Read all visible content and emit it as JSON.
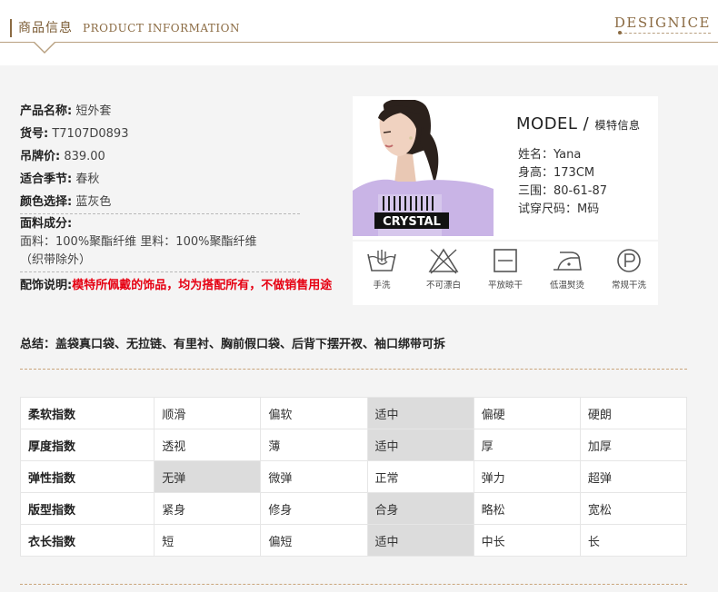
{
  "header": {
    "title_cn": "商品信息",
    "title_en": "PRODUCT INFORMATION",
    "brand": "DESIGNICE"
  },
  "product": {
    "name_label": "产品名称:",
    "name": "短外套",
    "sku_label": "货号:",
    "sku": "T7107D0893",
    "price_label": "吊牌价:",
    "price": "839.00",
    "season_label": "适合季节:",
    "season": "春秋",
    "color_label": "颜色选择:",
    "color": "蓝灰色",
    "fabric_label": "面料成分:",
    "fabric": "面料：100%聚酯纤维 里料：100%聚酯纤维",
    "fabric_note": "（织带除外）",
    "accessory_label": "配饰说明:",
    "accessory": "模特所佩戴的饰品，均为搭配所有，不做销售用途"
  },
  "model": {
    "title": "MODEL /",
    "title_sub": "模特信息",
    "name": "姓名：Yana",
    "height": "身高：173CM",
    "measurements": "三围：80-61-87",
    "size": "试穿尺码：M码",
    "shirt_text": "CRYSTAL"
  },
  "care": [
    {
      "label": "手洗",
      "icon": "hand-wash-icon"
    },
    {
      "label": "不可漂白",
      "icon": "no-bleach-icon"
    },
    {
      "label": "平放晾干",
      "icon": "dry-flat-icon"
    },
    {
      "label": "低温熨烫",
      "icon": "low-iron-icon"
    },
    {
      "label": "常规干洗",
      "icon": "dry-clean-icon"
    }
  ],
  "summary": "总结：盖袋真口袋、无拉链、有里衬、胸前假口袋、后背下摆开衩、袖口绑带可拆",
  "indices": [
    {
      "name": "柔软指数",
      "options": [
        "顺滑",
        "偏软",
        "适中",
        "偏硬",
        "硬朗"
      ],
      "selected": 2
    },
    {
      "name": "厚度指数",
      "options": [
        "透视",
        "薄",
        "适中",
        "厚",
        "加厚"
      ],
      "selected": 2
    },
    {
      "name": "弹性指数",
      "options": [
        "无弹",
        "微弹",
        "正常",
        "弹力",
        "超弹"
      ],
      "selected": 0
    },
    {
      "name": "版型指数",
      "options": [
        "紧身",
        "修身",
        "合身",
        "略松",
        "宽松"
      ],
      "selected": 2
    },
    {
      "name": "衣长指数",
      "options": [
        "短",
        "偏短",
        "适中",
        "中长",
        "长"
      ],
      "selected": 2
    }
  ],
  "colors": {
    "accent": "#8b6b43",
    "selected_cell": "#dcdcdc",
    "warning": "#e60012",
    "shirt": "#c9b4e6"
  }
}
